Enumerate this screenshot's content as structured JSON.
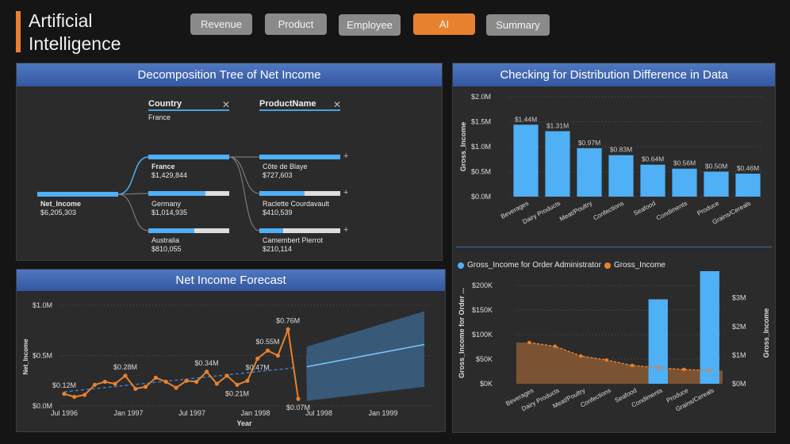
{
  "app": {
    "title_line1": "Artificial",
    "title_line2": "Intelligence"
  },
  "nav": [
    {
      "label": "Revenue",
      "active": false
    },
    {
      "label": "Product",
      "active": false
    },
    {
      "label": "Employee",
      "active": false
    },
    {
      "label": "AI",
      "active": true
    },
    {
      "label": "Summary",
      "active": false
    }
  ],
  "colors": {
    "accent": "#e8812f",
    "blue": "#4fb0f5",
    "header_blue": "#3f65b0",
    "orange": "#e8812f"
  },
  "decomp": {
    "title": "Decomposition Tree of Net Income",
    "level1_header": "Country",
    "level1_filter": "France",
    "level2_header": "ProductName",
    "close_icon": "close-icon",
    "root": {
      "label": "Net_Income",
      "value": "$6,205,303",
      "fraction": 1.0
    },
    "countries": [
      {
        "label": "France",
        "value": "$1,429,844",
        "fraction": 1.0
      },
      {
        "label": "Germany",
        "value": "$1,014,935",
        "fraction": 0.71
      },
      {
        "label": "Australia",
        "value": "$810,055",
        "fraction": 0.57
      }
    ],
    "products": [
      {
        "label": "Côte de Blaye",
        "value": "$727,603",
        "fraction": 1.0
      },
      {
        "label": "Raclette Courdavault",
        "value": "$410,539",
        "fraction": 0.56
      },
      {
        "label": "Camembert Pierrot",
        "value": "$210,114",
        "fraction": 0.29
      }
    ]
  },
  "forecast": {
    "title": "Net Income Forecast",
    "chart_data": {
      "type": "line",
      "ylabel": "Net_Income",
      "xlabel": "Year",
      "yticks": [
        "$0.0M",
        "$0.5M",
        "$1.0M"
      ],
      "xticks": [
        "Jul 1996",
        "Jan 1997",
        "Jul 1997",
        "Jan 1998",
        "Jul 1998",
        "Jan 1999"
      ],
      "ylim": [
        0,
        1.0
      ],
      "series": [
        {
          "values": [
            0.12,
            0.09,
            0.11,
            0.21,
            0.24,
            0.22,
            0.3,
            0.17,
            0.19,
            0.28,
            0.24,
            0.18,
            0.25,
            0.24,
            0.34,
            0.22,
            0.3,
            0.21,
            0.25,
            0.47,
            0.55,
            0.5,
            0.76,
            0.07
          ]
        }
      ],
      "forecast_line": [
        0.39,
        0.61
      ],
      "data_labels": [
        "$0.12M",
        "$0.28M",
        "$0.34M",
        "$0.21M",
        "$0.55M",
        "$0.47M",
        "$0.76M",
        "$0.07M"
      ]
    }
  },
  "distribution": {
    "title": "Checking for Distribution Difference in Data",
    "chart_data": {
      "type": "bar",
      "ylabel": "Gross_Income",
      "yticks": [
        "$0.0M",
        "$0.5M",
        "$1.0M",
        "$1.5M",
        "$2.0M"
      ],
      "ylim": [
        0,
        2.0
      ],
      "categories": [
        "Beverages",
        "Dairy Products",
        "Meat/Poultry",
        "Confections",
        "Seafood",
        "Condiments",
        "Produce",
        "Grains/Cereals"
      ],
      "values": [
        1.44,
        1.31,
        0.97,
        0.83,
        0.64,
        0.56,
        0.5,
        0.46
      ],
      "data_labels": [
        "$1.44M",
        "$1.31M",
        "$0.97M",
        "$0.83M",
        "$0.64M",
        "$0.56M",
        "$0.50M",
        "$0.46M"
      ]
    }
  },
  "combo": {
    "chart_data": {
      "type": "bar",
      "legend": [
        "Gross_Income for Order Administrator",
        "Gross_Income"
      ],
      "ylabel_left": "Gross_Income for Order ...",
      "ylabel_right": "Gross_Income",
      "yticks_left": [
        "$0K",
        "$50K",
        "$100K",
        "$150K",
        "$200K"
      ],
      "yticks_right": [
        "$0M",
        "$1M",
        "$2M",
        "$3M"
      ],
      "categories": [
        "Beverages",
        "Dairy Products",
        "Meat/Poultry",
        "Confections",
        "Seafood",
        "Condiments",
        "Produce",
        "Grains/Cereals"
      ],
      "series": [
        {
          "name": "Gross_Income for Order Administrator",
          "values": [
            0,
            0,
            0,
            0,
            0,
            172000,
            0,
            235000
          ]
        },
        {
          "name": "Gross_Income",
          "values": [
            1.44,
            1.31,
            0.97,
            0.83,
            0.64,
            0.56,
            0.5,
            0.46
          ]
        }
      ],
      "ylim_left": [
        0,
        210000
      ],
      "ylim_right": [
        0,
        3.6
      ]
    }
  }
}
